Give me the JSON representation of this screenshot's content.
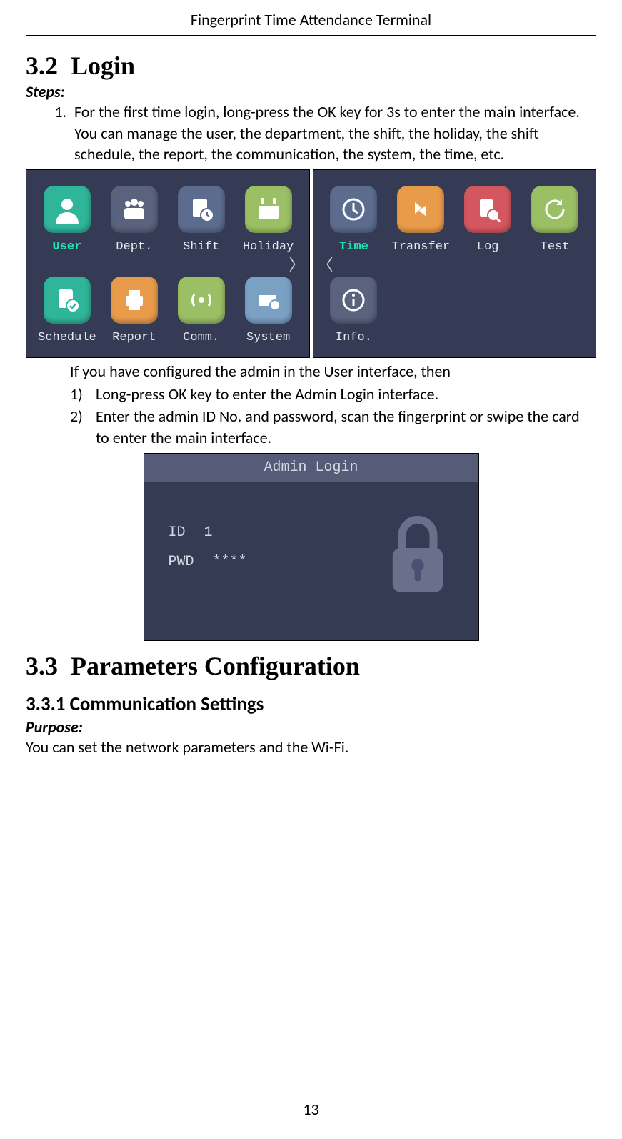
{
  "header": {
    "title": "Fingerprint Time Attendance Terminal"
  },
  "section_login": {
    "number": "3.2",
    "title": "Login",
    "steps_label": "Steps:",
    "step1a": "For the first time login, long-press the OK key for 3s to enter the main interface.",
    "step1b": "You can manage the user, the department, the shift, the holiday, the shift schedule, the report, the communication, the system, the time, etc.",
    "after_grid": "If you have configured the admin in the User interface, then",
    "sub1": "Long-press OK key to enter the Admin Login interface.",
    "sub2": "Enter the admin ID No. and password, scan the fingerprint or swipe the card to enter the main interface."
  },
  "screens": {
    "left": {
      "selected_index": 0,
      "items": [
        {
          "label": "User",
          "color": "t-teal",
          "icon": "user"
        },
        {
          "label": "Dept.",
          "color": "t-slate",
          "icon": "people"
        },
        {
          "label": "Shift",
          "color": "t-blue",
          "icon": "clock-doc"
        },
        {
          "label": "Holiday",
          "color": "t-green",
          "icon": "calendar"
        },
        {
          "label": "Schedule",
          "color": "t-teal",
          "icon": "check-doc"
        },
        {
          "label": "Report",
          "color": "t-orange",
          "icon": "printer"
        },
        {
          "label": "Comm.",
          "color": "t-green",
          "icon": "wifi"
        },
        {
          "label": "System",
          "color": "t-ltblue",
          "icon": "gear-window"
        }
      ],
      "pager": "〉"
    },
    "right": {
      "selected_index": 0,
      "items": [
        {
          "label": "Time",
          "color": "t-blue",
          "icon": "clock"
        },
        {
          "label": "Transfer",
          "color": "t-orange",
          "icon": "transfer"
        },
        {
          "label": "Log",
          "color": "t-red",
          "icon": "log"
        },
        {
          "label": "Test",
          "color": "t-green",
          "icon": "refresh"
        },
        {
          "label": "Info.",
          "color": "t-slate",
          "icon": "info"
        }
      ],
      "pager": "〈"
    }
  },
  "admin_login": {
    "title": "Admin Login",
    "id_label": "ID",
    "id_value": "1",
    "pwd_label": "PWD",
    "pwd_value": "****"
  },
  "section_params": {
    "number": "3.3",
    "title": "Parameters Configuration",
    "sub_number": "3.3.1",
    "sub_title": "Communication Settings",
    "purpose_label": "Purpose:",
    "purpose_text": "You can set the network parameters and the Wi-Fi."
  },
  "footer": {
    "page": "13"
  }
}
